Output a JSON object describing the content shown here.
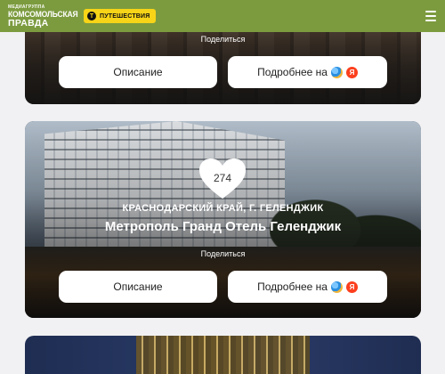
{
  "header": {
    "logo_top": "МЕДИАГРУППА",
    "logo_mid": "КОМСОМОЛЬСКАЯ",
    "logo_bot": "ПРАВДА",
    "section_badge_icon": "Т",
    "section_badge": "ПУТЕШЕСТВИЯ",
    "menu_icon": "hamburger-menu-icon"
  },
  "cards": [
    {
      "share_label": "Поделиться",
      "description_button": "Описание",
      "more_button": "Подробнее на",
      "more_icons": [
        "globe-icon",
        "yandex-icon"
      ],
      "yandex_letter": "Я"
    },
    {
      "likes": "274",
      "region": "КРАСНОДАРСКИЙ КРАЙ, Г. ГЕЛЕНДЖИК",
      "title": "Метрополь Гранд Отель Геленджик",
      "share_label": "Поделиться",
      "description_button": "Описание",
      "more_button": "Подробнее на",
      "more_icons": [
        "globe-icon",
        "yandex-icon"
      ],
      "yandex_letter": "Я"
    },
    {}
  ],
  "colors": {
    "header_bg": "#7c9b3f",
    "badge_bg": "#f7d417",
    "yandex_red": "#fc3f1d",
    "page_bg": "#f1f1f3"
  }
}
